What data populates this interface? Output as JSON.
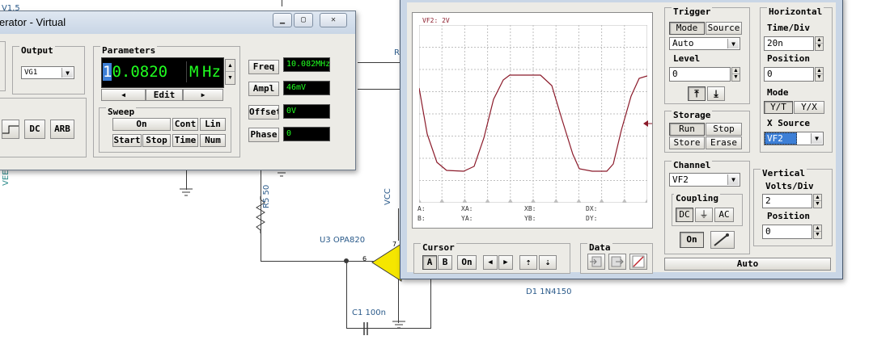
{
  "schematic": {
    "top_label": "V1.5",
    "left_label": "VEE",
    "resistor_r": "R",
    "resistor_label": "R5 50",
    "vcc_label": "VCC",
    "opamp_label": "U3 OPA820",
    "opamp_pin": "6",
    "opamp_pin2": "7",
    "diode_label": "D1 1N4150",
    "cap_label": "C1 100n"
  },
  "fgen": {
    "title": "erator - Virtual",
    "caption_buttons": [
      "▁",
      "▢",
      "✕"
    ],
    "output": {
      "group": "Output",
      "selected": "VG1"
    },
    "wave_buttons": [
      "DC",
      "ARB"
    ],
    "parameters": {
      "group": "Parameters",
      "display_value": "10.0820",
      "display_value_first": "1",
      "display_value_rest": "0.0820",
      "display_unit_prefix": "M",
      "display_unit": "Hz",
      "edit_label": "Edit",
      "left_arrow": "◀",
      "right_arrow": "▶",
      "spin_up": "▲",
      "spin_down": "▼"
    },
    "sweep": {
      "group": "Sweep",
      "row1": [
        "On",
        "Cont",
        "Lin"
      ],
      "row2": [
        "Start",
        "Stop",
        "Time",
        "Num"
      ]
    },
    "fields": [
      {
        "label": "Freq",
        "value": "10.082MHz"
      },
      {
        "label": "Ampl",
        "value": "46mV"
      },
      {
        "label": "Offset",
        "value": "0V"
      },
      {
        "label": "Phase",
        "value": "0"
      }
    ]
  },
  "scope": {
    "screen_label": "VF2: 2V",
    "readouts": {
      "a": "A:",
      "b": "B:",
      "xa": "XA:",
      "ya": "YA:",
      "xb": "XB:",
      "yb": "YB:",
      "dx": "DX:",
      "dy": "DY:"
    },
    "trigger": {
      "group": "Trigger",
      "mode_label": "Mode",
      "source_label": "Source",
      "mode_selected": "Auto",
      "level_label": "Level",
      "level_value": "0",
      "edge_rising": "⤒",
      "edge_falling": "⤓"
    },
    "storage": {
      "group": "Storage",
      "buttons": [
        "Run",
        "Stop",
        "Store",
        "Erase"
      ]
    },
    "horizontal": {
      "group": "Horizontal",
      "timediv_label": "Time/Div",
      "timediv_value": "20n",
      "position_label": "Position",
      "position_value": "0",
      "mode_label": "Mode",
      "modes": [
        "Y/T",
        "Y/X"
      ],
      "xsource_label": "X Source",
      "xsource_value": "VF2"
    },
    "channel": {
      "group": "Channel",
      "selected": "VF2",
      "coupling_label": "Coupling",
      "coupling": [
        "DC",
        "⏚",
        "AC"
      ],
      "on_label": "On"
    },
    "vertical": {
      "group": "Vertical",
      "voltsdiv_label": "Volts/Div",
      "voltsdiv_value": "2",
      "position_label": "Position",
      "position_value": "0"
    },
    "cursor": {
      "group": "Cursor",
      "buttons": [
        "A",
        "B",
        "On",
        "◀",
        "▶",
        "⇡",
        "⇣"
      ]
    },
    "data": {
      "group": "Data"
    },
    "auto_label": "Auto"
  },
  "colors": {
    "trace": "#8b1a2a",
    "lcd_text": "#20ff20",
    "highlight": "#3d7fd6",
    "opamp": "#f5e600"
  }
}
